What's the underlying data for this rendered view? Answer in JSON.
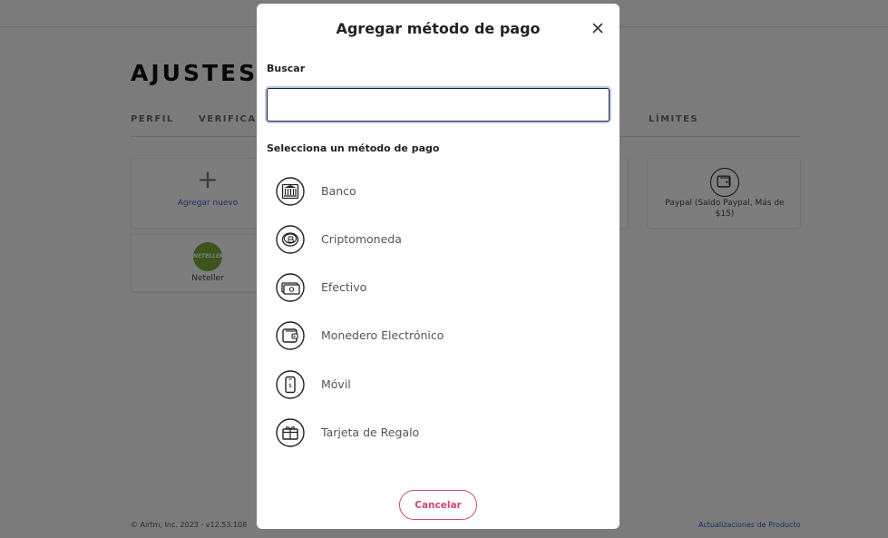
{
  "page": {
    "title": "AJUSTES",
    "tabs": [
      "PERFIL",
      "VERIFICAC",
      "LÍMITES"
    ],
    "cards": {
      "add_new": "Agregar nuevo",
      "neteller": "Neteller",
      "neteller_logo": "NETELLER",
      "paypal": "Paypal (Saldo Paypal, Más de $15)"
    },
    "footer": {
      "left": "© Airtm, Inc. 2023 - v12.53.108",
      "right": "Actualizaciones de Producto"
    }
  },
  "modal": {
    "title": "Agregar método de pago",
    "search_label": "Buscar",
    "search_value": "",
    "section_label": "Selecciona un método de pago",
    "methods": [
      {
        "label": "Banco",
        "icon": "bank-icon"
      },
      {
        "label": "Criptomoneda",
        "icon": "crypto-coin-icon"
      },
      {
        "label": "Efectivo",
        "icon": "cash-icon"
      },
      {
        "label": "Monedero Electrónico",
        "icon": "wallet-icon"
      },
      {
        "label": "Móvil",
        "icon": "mobile-icon"
      },
      {
        "label": "Tarjeta de Regalo",
        "icon": "gift-card-icon"
      }
    ],
    "cancel_label": "Cancelar"
  },
  "colors": {
    "accent_link": "#3b5bc4",
    "cancel": "#c9486b",
    "neteller_green": "#7aab3b"
  }
}
